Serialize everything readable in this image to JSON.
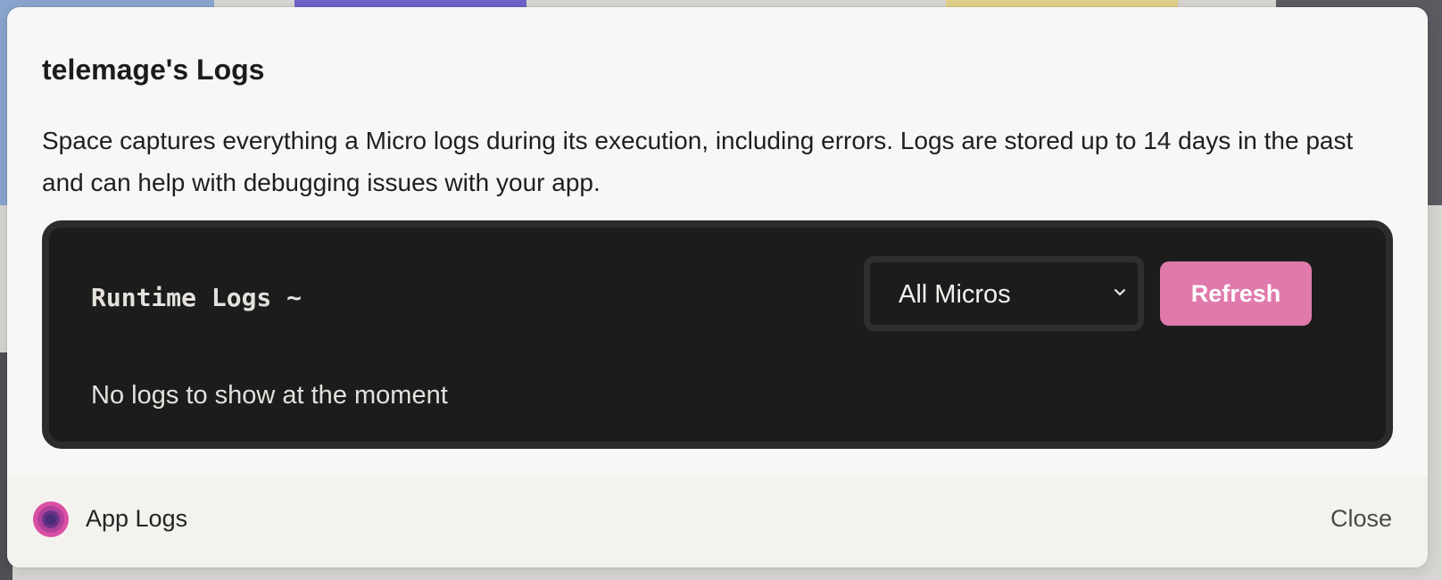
{
  "modal": {
    "title": "telemage's Logs",
    "description": "Space captures everything a Micro logs during its execution, including errors. Logs are stored up to 14 days in the past and can help with debugging issues with your app."
  },
  "logs_panel": {
    "title": "Runtime Logs ~",
    "filter": {
      "selected": "All Micros",
      "icon": "chevron-down-icon"
    },
    "refresh_label": "Refresh",
    "empty_message": "No logs to show at the moment",
    "colors": {
      "panel_bg": "#1c1c1c",
      "refresh_bg": "#e07aac"
    }
  },
  "footer": {
    "app_icon": "app-logs-icon",
    "app_label": "App Logs",
    "close_label": "Close"
  }
}
